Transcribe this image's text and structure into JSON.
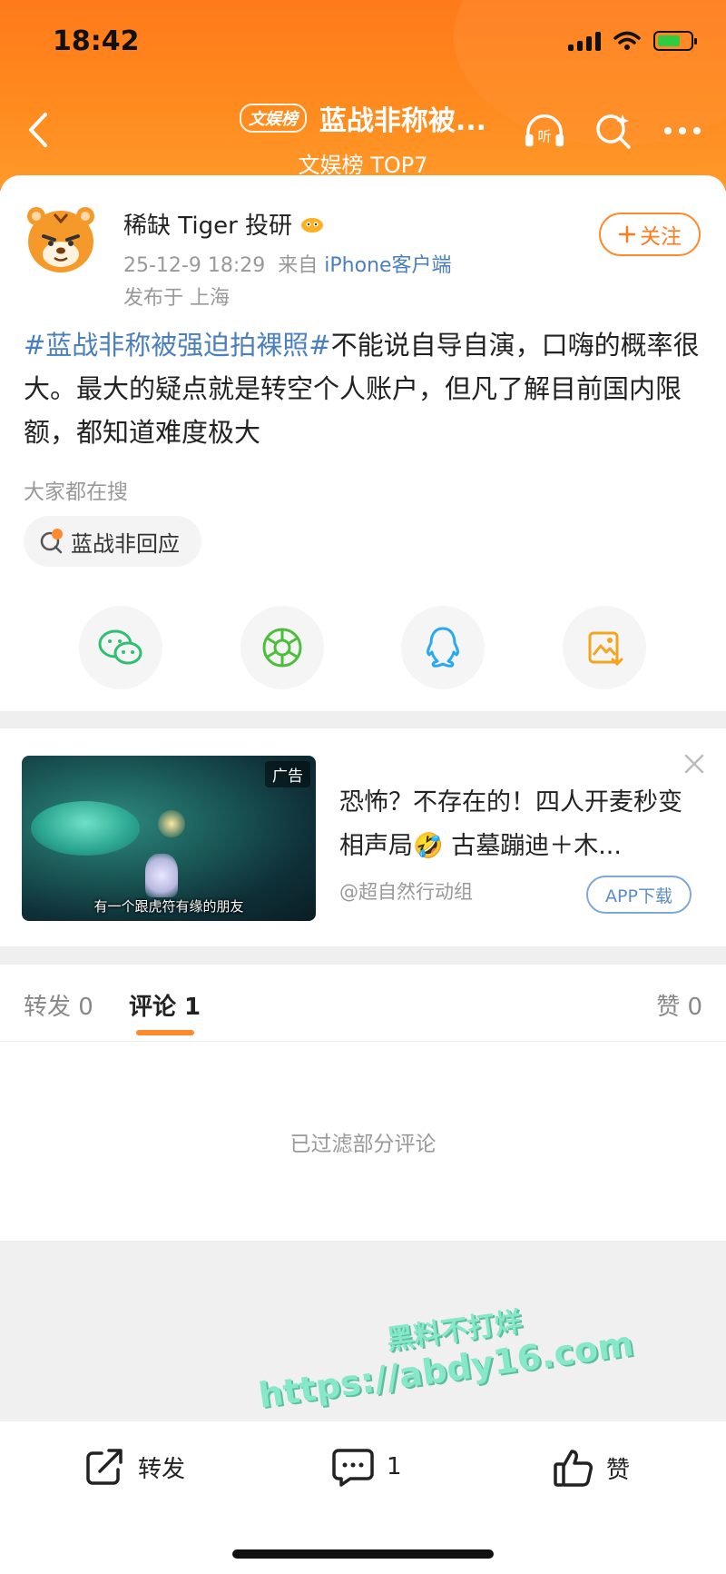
{
  "status_bar": {
    "time": "18:42"
  },
  "header": {
    "badge": "文娱榜",
    "title": "蓝战非称被...",
    "subtitle": "文娱榜 TOP7",
    "listen_label": "听"
  },
  "post": {
    "author": "稀缺 Tiger 投研",
    "date": "25-12-9 18:29",
    "from_prefix": "来自",
    "source": "iPhone客户端",
    "location": "发布于 上海",
    "follow_label": "关注",
    "topic": "#蓝战非称被强迫拍裸照#",
    "body": "不能说自导自演，口嗨的概率很大。最大的疑点就是转空个人账户，但凡了解目前国内限额，都知道难度极大",
    "search_label": "大家都在搜",
    "search_chip": "蓝战非回应"
  },
  "ad": {
    "tag": "广告",
    "video_caption": "有一个跟虎符有缘的朋友",
    "title": "恐怖？不存在的！四人开麦秒变相声局🤣 古墓蹦迪＋木...",
    "source": "@超自然行动组",
    "download_label": "APP下载"
  },
  "tabs": {
    "repost": "转发 0",
    "comments": "评论 1",
    "likes": "赞 0"
  },
  "comments": {
    "filtered_notice": "已过滤部分评论"
  },
  "watermark": {
    "line1": "黑料不打烊",
    "line2": "https://abdy16.com"
  },
  "bottom_bar": {
    "repost": "转发",
    "comment_count": "1",
    "like": "赞"
  },
  "colors": {
    "header_orange": "#ff7a1a",
    "accent_orange": "#ff8a2b",
    "link_blue": "#4a7fbf"
  }
}
